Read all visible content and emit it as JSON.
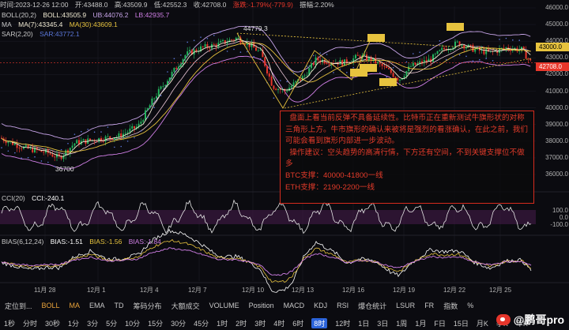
{
  "header": {
    "line1": {
      "time": "时间:2023-12-26 12:00",
      "open": "开:43488.0",
      "high": "高:43509.9",
      "low": "低:42552.3",
      "close": "收:42708.0",
      "change": "涨跌:-1.79%(-779.9)",
      "amplitude": "振幅:2.20%"
    },
    "line2": {
      "boll": "BOLL(20,2)",
      "boll_val": "BOLL:43505.9",
      "ub": "UB:44076.2",
      "lb": "LB:42935.7"
    },
    "line3": {
      "ma_label": "MA",
      "ma7": "MA(7):43345.4",
      "ma30": "MA(30):43609.1"
    },
    "line4": {
      "sar": "SAR(2,20)",
      "sar_val": "SAR:43772.1"
    }
  },
  "price_axis": {
    "ticks": [
      "46000.0",
      "45000.0",
      "44000.0",
      "43000.0",
      "42000.0",
      "41000.0",
      "40000.0",
      "39000.0",
      "38000.0",
      "37000.0",
      "36000.0"
    ],
    "current_price": "42708.0",
    "marker_price": "43000.0"
  },
  "annotations": {
    "high_label": "44779.3",
    "low_label": "36700"
  },
  "cci": {
    "label": "CCI(20)",
    "value": "CCI:-240.1",
    "ticks": [
      "100.0",
      "0.0",
      "-100.0"
    ]
  },
  "bias": {
    "label": "BIAS(6,12,24)",
    "b1": "BIAS:-1.51",
    "b2": "BIAS:-1.56",
    "b3": "BIAS:-1.84"
  },
  "x_axis": {
    "labels": [
      "11月 28",
      "12月 1",
      "12月 4",
      "12月 7",
      "12月 10",
      "12月 13",
      "12月 16",
      "12月 19",
      "12月 22",
      "12月 25"
    ]
  },
  "note": {
    "paragraphs": [
      "  盘面上看当前反弹不具备延续性。比特币正在重新测试牛旗形状的对称三角形上方。牛市旗形的确认来被将是强烈的看涨确认，在此之前，我们可能会看到旗形内部进一步波动。",
      "  操作建议：空头趋势的高清行情，下方还有空间，不到关键支撑位不做多",
      "BTC支撑：40000-41800一线",
      "ETH支撑：2190-2200一线"
    ]
  },
  "toolbar1": {
    "items": [
      "定位到...",
      "BOLL",
      "MA",
      "EMA",
      "TD",
      "筹码分布",
      "大额成交",
      "VOLUME",
      "Position",
      "MACD",
      "KDJ",
      "RSI",
      "爆仓统计",
      "LSUR",
      "FR",
      "指数",
      "%"
    ]
  },
  "toolbar2": {
    "items": [
      "1秒",
      "分时",
      "30秒",
      "1分",
      "3分",
      "5分",
      "10分",
      "15分",
      "30分",
      "45分",
      "1时",
      "2时",
      "3时",
      "4时",
      "6时",
      "8时",
      "12时",
      "1日",
      "3日",
      "1周",
      "1月",
      "F日",
      "15日",
      "月K",
      "季K",
      "年K"
    ]
  },
  "watermark": {
    "text": "@鹏哥pro"
  },
  "colors": {
    "up": "#23b45d",
    "down": "#e8372b",
    "ma7": "#f0ead2",
    "ma30": "#e7c33e",
    "boll": "#ecc9d8",
    "ub": "#c7a4e8",
    "lb": "#d07fe6",
    "sar": "#5a76d8",
    "accent": "#e9a33a"
  }
}
